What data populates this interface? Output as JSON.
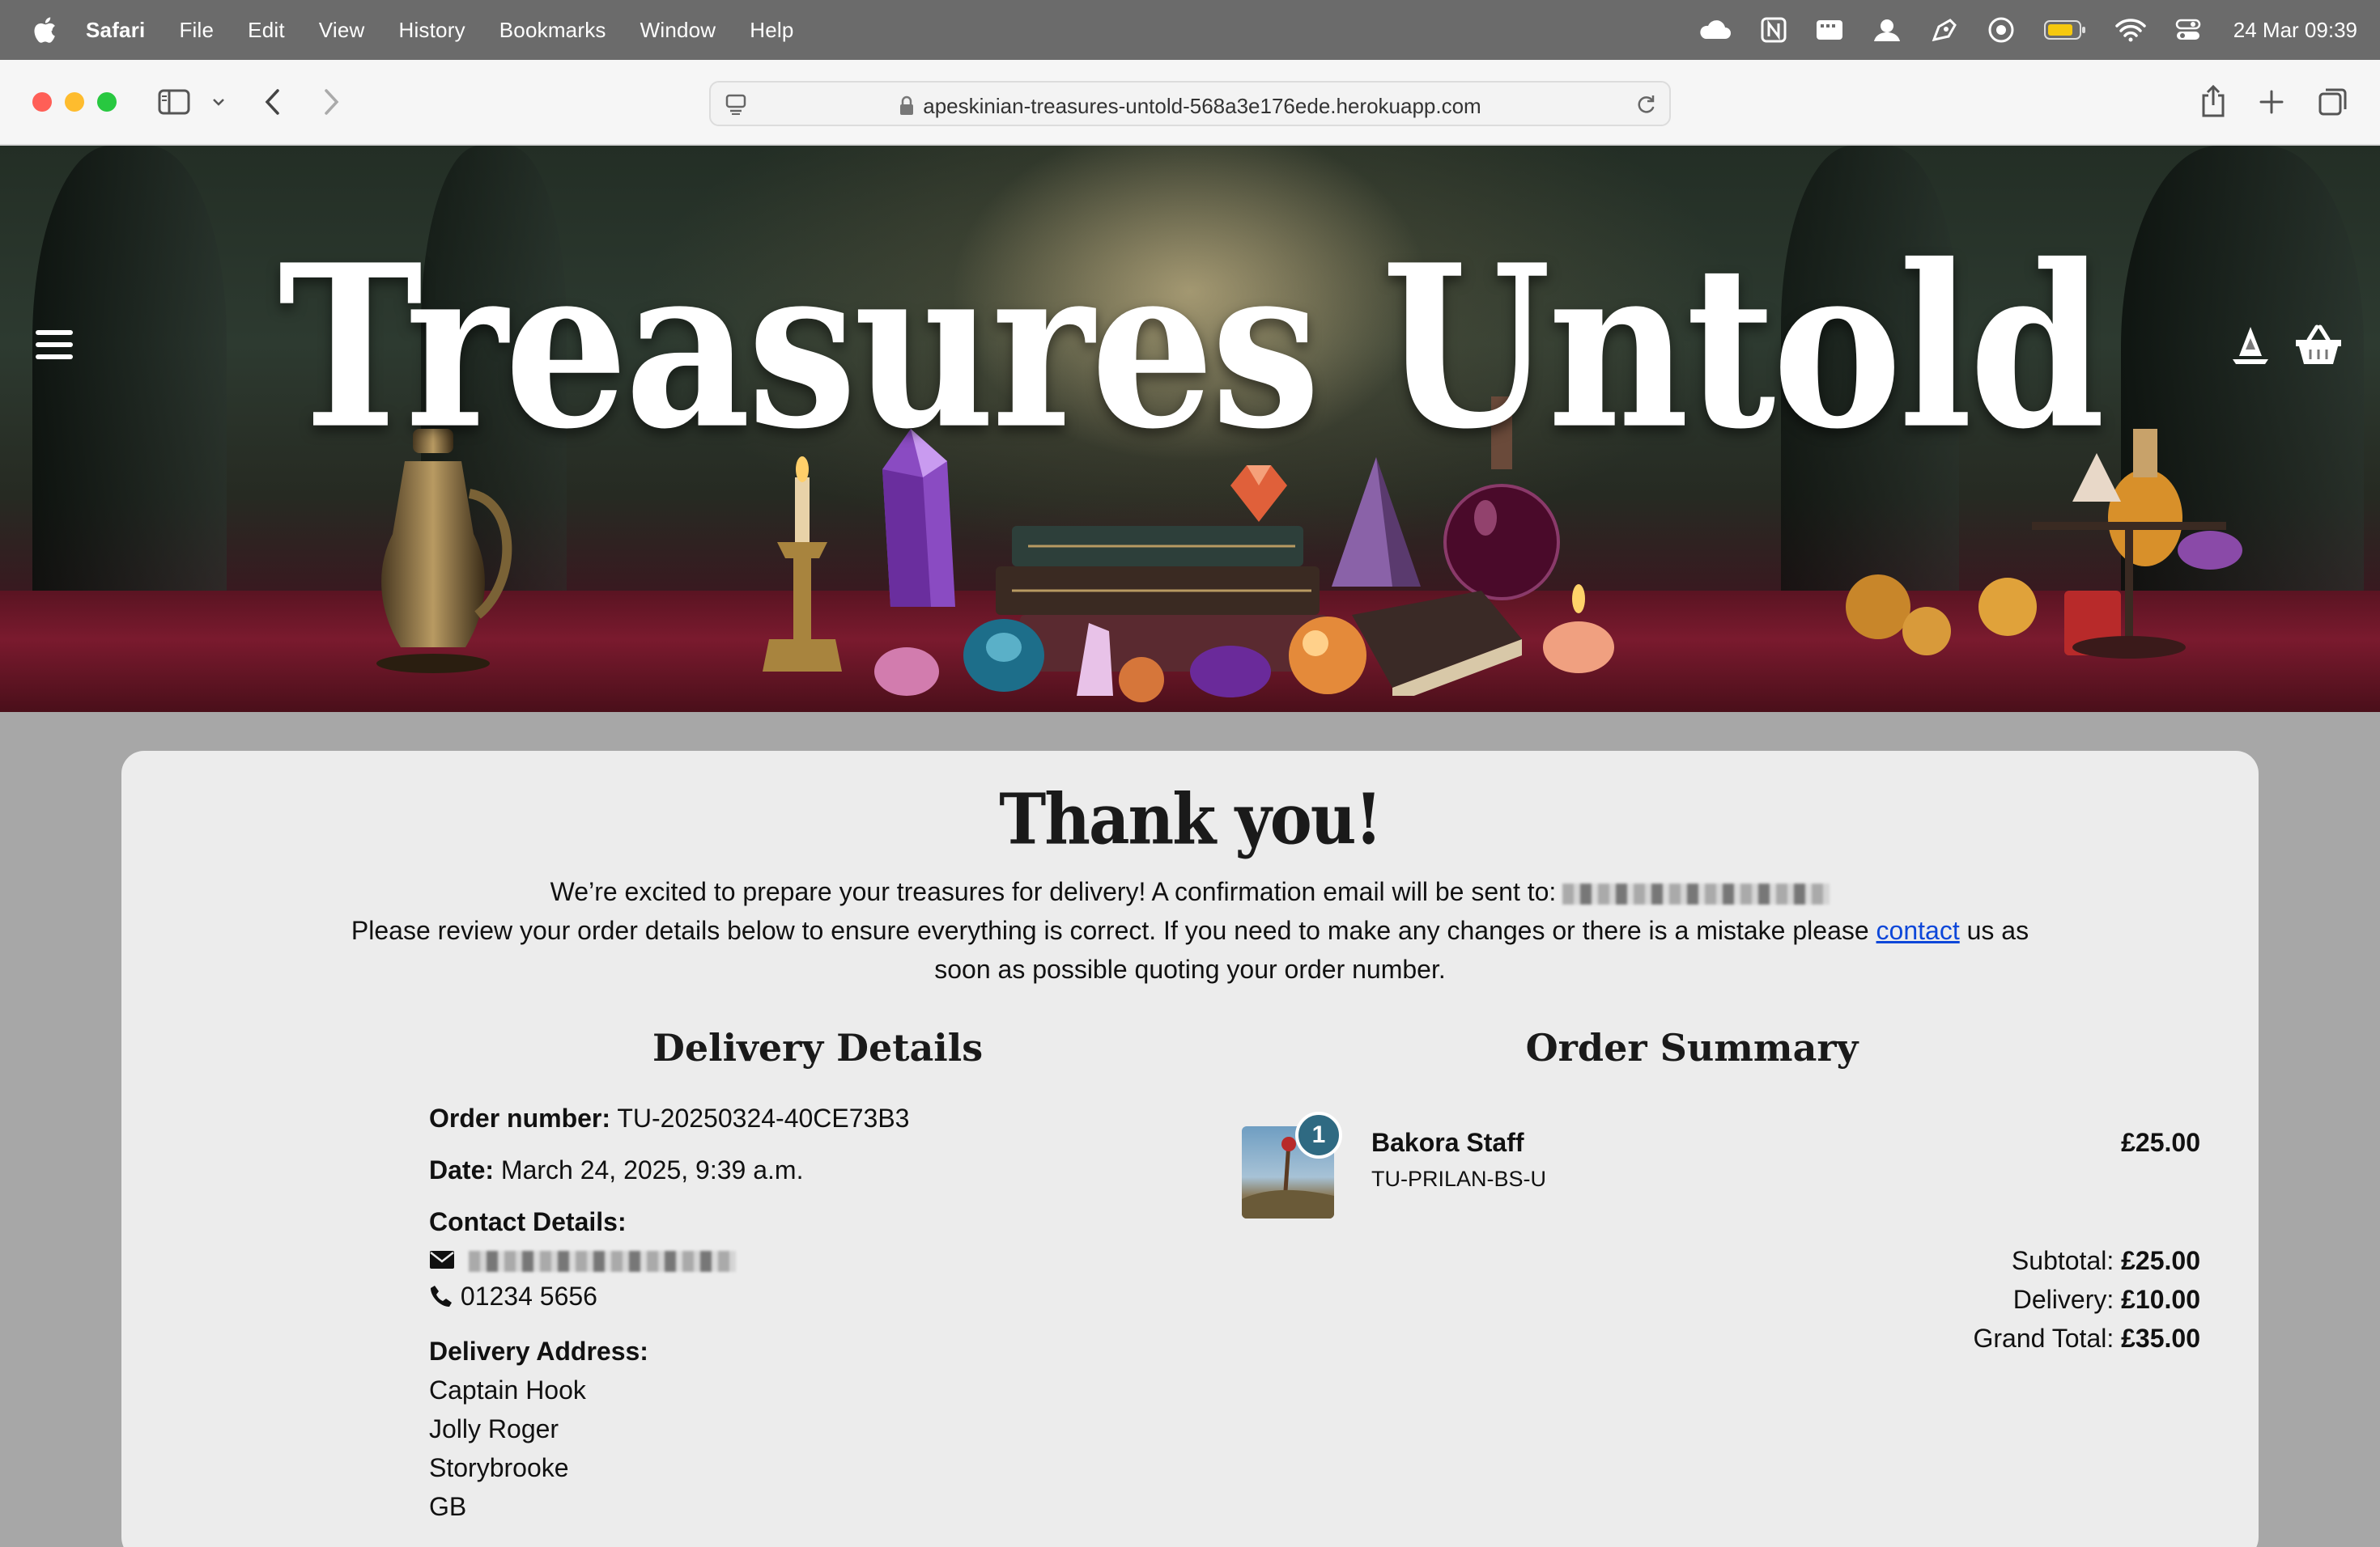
{
  "menubar": {
    "app_name": "Safari",
    "menus": [
      "File",
      "Edit",
      "View",
      "History",
      "Bookmarks",
      "Window",
      "Help"
    ],
    "clock": "24 Mar  09:39",
    "status_icons": [
      "cloud-icon",
      "notion-icon",
      "keyboard-icon",
      "user-icon",
      "pen-icon",
      "record-icon",
      "battery-icon",
      "wifi-icon",
      "control-center-icon"
    ]
  },
  "browser": {
    "url": "apeskinian-treasures-untold-568a3e176ede.herokuapp.com",
    "traffic_colors": [
      "#ff5f57",
      "#febc2e",
      "#28c840"
    ]
  },
  "hero": {
    "title": "Treasures Untold"
  },
  "page": {
    "heading": "Thank you!",
    "intro_line1": "We’re excited to prepare your treasures for delivery! A confirmation email will be sent to:",
    "intro_line2_a": "Please review your order details below to ensure everything is correct. If you need to make any changes or there is a mistake please",
    "intro_link": "contact",
    "intro_line2_b": "us as",
    "intro_line3": "soon as possible quoting your order number."
  },
  "delivery": {
    "title": "Delivery Details",
    "order_number_label": "Order number:",
    "order_number": "TU-20250324-40CE73B3",
    "date_label": "Date:",
    "date": "March 24, 2025, 9:39 a.m.",
    "contact_label": "Contact Details:",
    "phone": "01234 5656",
    "address_label": "Delivery Address:",
    "address": [
      "Captain Hook",
      "Jolly Roger",
      "Storybrooke",
      "GB"
    ]
  },
  "summary": {
    "title": "Order Summary",
    "items": [
      {
        "quantity": "1",
        "name": "Bakora Staff",
        "sku": "TU-PRILAN-BS-U",
        "price": "£25.00"
      }
    ],
    "subtotal_label": "Subtotal:",
    "subtotal": "£25.00",
    "delivery_label": "Delivery:",
    "delivery": "£10.00",
    "grand_total_label": "Grand Total:",
    "grand_total": "£35.00"
  },
  "colors": {
    "link": "#0d47d9",
    "badge": "#2f6a82",
    "card": "#ececec"
  }
}
